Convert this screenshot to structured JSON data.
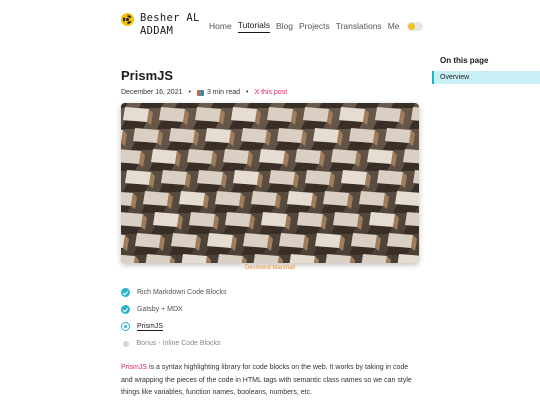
{
  "header": {
    "logo_line1": "Besher AL",
    "logo_line2": "ADDAM",
    "nav": [
      {
        "label": "Home",
        "active": false
      },
      {
        "label": "Tutorials",
        "active": true
      },
      {
        "label": "Blog",
        "active": false
      },
      {
        "label": "Projects",
        "active": false
      },
      {
        "label": "Translations",
        "active": false
      },
      {
        "label": "Me",
        "active": false
      }
    ],
    "theme_toggle_icon": "sun-toggle-icon"
  },
  "toc": {
    "title": "On this page",
    "items": [
      "Overview"
    ]
  },
  "article": {
    "title": "PrismJS",
    "date": "December 16, 2021",
    "read_time": "3 min read",
    "x_link": "X this post",
    "image_caption": "Desmond Marshall",
    "steps": [
      {
        "label": "Rich Markdown Code Blocks",
        "state": "done"
      },
      {
        "label": "Gatsby + MDX",
        "state": "done"
      },
      {
        "label": "PrismJS",
        "state": "current"
      },
      {
        "label": "Bonus - Inline Code Blocks",
        "state": "pending"
      }
    ],
    "paragraph_link": "PrismJS",
    "paragraph_rest": " is a syntax highlighting library for code blocks on the web. It works by taking in code and wrapping the pieces of the code in HTML tags with semantic class names so we can style things like variables, function names, booleans, numbers, etc."
  },
  "colors": {
    "accent": "#18b7cd",
    "link": "#e2246b",
    "caption": "#e88f2a",
    "toc_active_bg": "#c9f0f5"
  }
}
